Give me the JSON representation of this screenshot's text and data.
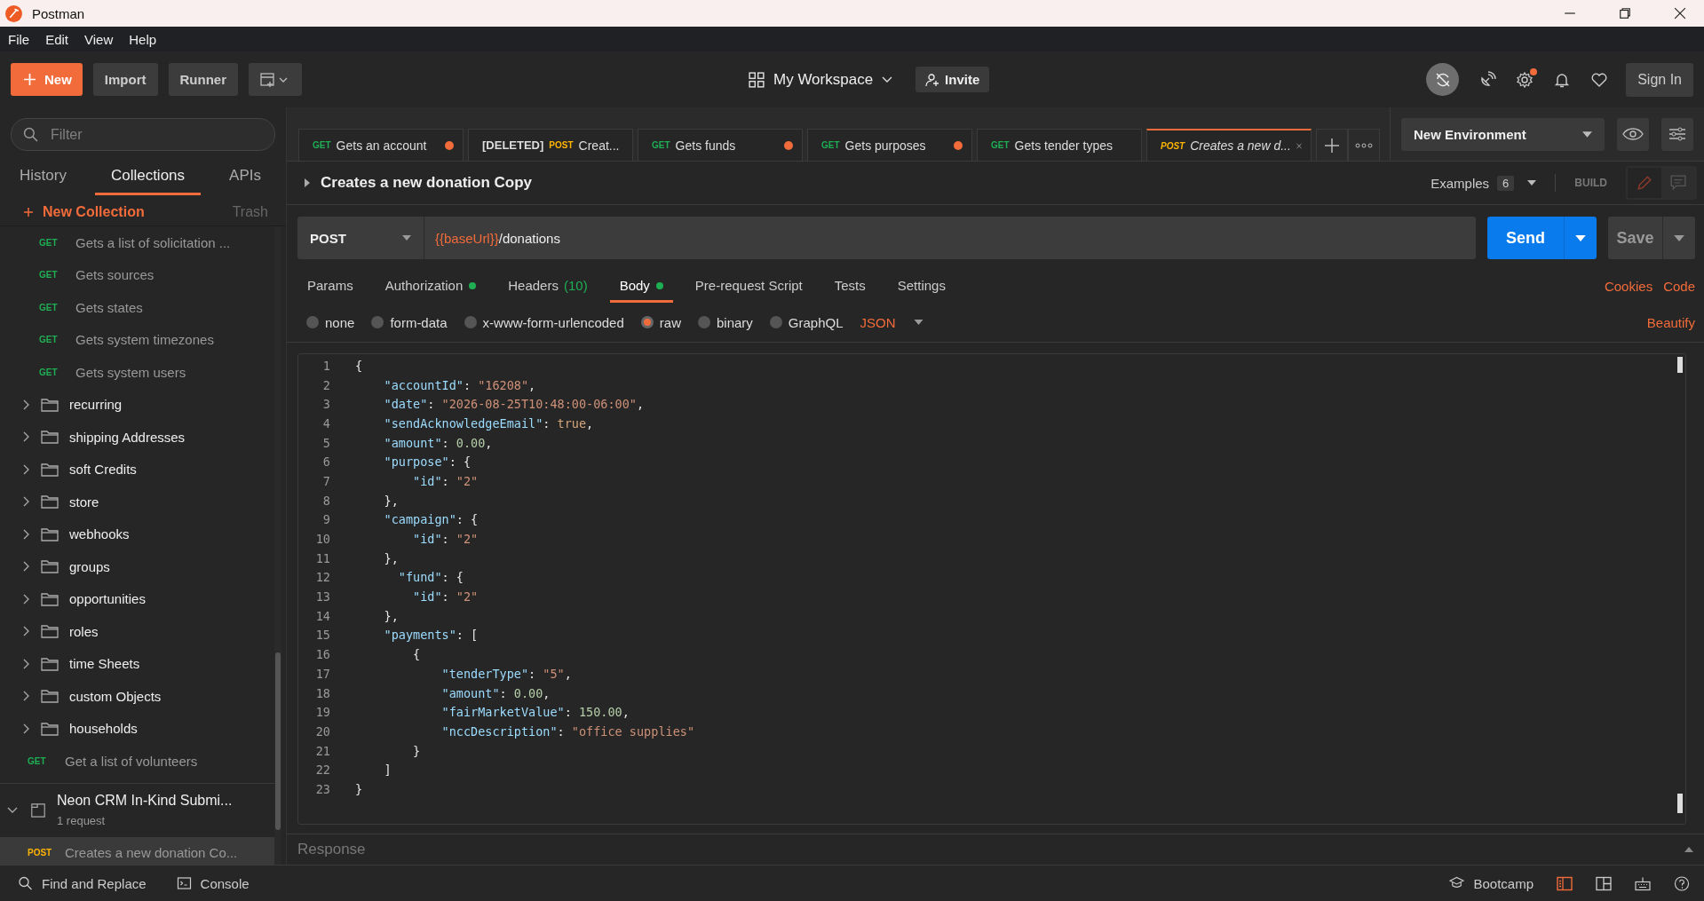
{
  "window": {
    "title": "Postman"
  },
  "menu": [
    "File",
    "Edit",
    "View",
    "Help"
  ],
  "toolbar": {
    "new_button": "New",
    "import_button": "Import",
    "runner_button": "Runner",
    "workspace": "My Workspace",
    "invite_button": "Invite",
    "sign_in_button": "Sign In",
    "settings_badge": true
  },
  "sidebar": {
    "filter_placeholder": "Filter",
    "tabs": [
      {
        "label": "History",
        "selected": false
      },
      {
        "label": "Collections",
        "selected": true
      },
      {
        "label": "APIs",
        "selected": false
      }
    ],
    "new_collection": "New Collection",
    "trash": "Trash",
    "items": [
      {
        "kind": "folder_request",
        "method": "GET",
        "name": "Gets a list of solicitation ..."
      },
      {
        "kind": "folder_request",
        "method": "GET",
        "name": "Gets sources"
      },
      {
        "kind": "folder_request",
        "method": "GET",
        "name": "Gets states"
      },
      {
        "kind": "folder_request",
        "method": "GET",
        "name": "Gets system timezones"
      },
      {
        "kind": "folder_request",
        "method": "GET",
        "name": "Gets system users"
      },
      {
        "kind": "folder",
        "name": "recurring",
        "expanded": false
      },
      {
        "kind": "folder",
        "name": "shipping Addresses",
        "expanded": false
      },
      {
        "kind": "folder",
        "name": "soft Credits",
        "expanded": false
      },
      {
        "kind": "folder",
        "name": "store",
        "expanded": false
      },
      {
        "kind": "folder",
        "name": "webhooks",
        "expanded": false
      },
      {
        "kind": "folder",
        "name": "groups",
        "expanded": false
      },
      {
        "kind": "folder",
        "name": "opportunities",
        "expanded": false
      },
      {
        "kind": "folder",
        "name": "roles",
        "expanded": false
      },
      {
        "kind": "folder",
        "name": "time Sheets",
        "expanded": false
      },
      {
        "kind": "folder",
        "name": "custom Objects",
        "expanded": false
      },
      {
        "kind": "folder",
        "name": "households",
        "expanded": false
      },
      {
        "kind": "request",
        "method": "GET",
        "name": "Get a list of volunteers"
      }
    ],
    "collections": [
      {
        "name": "Neon CRM In-Kind Submi...",
        "count": "1 request",
        "expanded": true,
        "children": [
          {
            "method": "POST",
            "name": "Creates a new donation Co...",
            "selected": true
          }
        ]
      }
    ]
  },
  "tabs": [
    {
      "method": "GET",
      "name": "Gets an account",
      "modified": true,
      "selected": false
    },
    {
      "method": "POST",
      "prefix": "[DELETED]",
      "name": "Creat...",
      "modified": false,
      "selected": false
    },
    {
      "method": "GET",
      "name": "Gets funds",
      "modified": true,
      "selected": false
    },
    {
      "method": "GET",
      "name": "Gets purposes",
      "modified": true,
      "selected": false
    },
    {
      "method": "GET",
      "name": "Gets tender types",
      "modified": false,
      "selected": false
    },
    {
      "method": "POST",
      "name": "Creates a new d...",
      "modified": false,
      "selected": true
    }
  ],
  "environment": "New Environment",
  "request": {
    "title": "Creates a new donation Copy",
    "examples_label": "Examples",
    "examples_count": "6",
    "build_label": "BUILD",
    "method": "POST",
    "url_variable": "{{baseUrl}}",
    "url_path": "/donations",
    "send_button": "Send",
    "save_button": "Save",
    "tabs": [
      {
        "label": "Params",
        "dot": false,
        "selected": false
      },
      {
        "label": "Authorization",
        "dot": true,
        "selected": false
      },
      {
        "label": "Headers",
        "dot": false,
        "count": "(10)",
        "selected": false
      },
      {
        "label": "Body",
        "dot": true,
        "selected": true
      },
      {
        "label": "Pre-request Script",
        "dot": false,
        "selected": false
      },
      {
        "label": "Tests",
        "dot": false,
        "selected": false
      },
      {
        "label": "Settings",
        "dot": false,
        "selected": false
      }
    ],
    "links": [
      "Cookies",
      "Code"
    ],
    "body_modes": [
      {
        "label": "none",
        "selected": false
      },
      {
        "label": "form-data",
        "selected": false
      },
      {
        "label": "x-www-form-urlencoded",
        "selected": false
      },
      {
        "label": "raw",
        "selected": true
      },
      {
        "label": "binary",
        "selected": false
      },
      {
        "label": "GraphQL",
        "selected": false
      }
    ],
    "format": "JSON",
    "beautify": "Beautify",
    "code": [
      {
        "number": "1",
        "tokens": [
          {
            "kind": "punct",
            "text": "{"
          }
        ]
      },
      {
        "number": "2",
        "tokens": [
          {
            "kind": "key",
            "text": "    \"accountId\""
          },
          {
            "kind": "punct",
            "text": ": "
          },
          {
            "kind": "string",
            "text": "\"16208\""
          },
          {
            "kind": "punct",
            "text": ","
          }
        ]
      },
      {
        "number": "3",
        "tokens": [
          {
            "kind": "key",
            "text": "    \"date\""
          },
          {
            "kind": "punct",
            "text": ": "
          },
          {
            "kind": "string",
            "text": "\"2026-08-25T10:48:00-06:00\""
          },
          {
            "kind": "punct",
            "text": ","
          }
        ]
      },
      {
        "number": "4",
        "tokens": [
          {
            "kind": "key",
            "text": "    \"sendAcknowledgeEmail\""
          },
          {
            "kind": "punct",
            "text": ": "
          },
          {
            "kind": "bool",
            "text": "true"
          },
          {
            "kind": "punct",
            "text": ","
          }
        ]
      },
      {
        "number": "5",
        "tokens": [
          {
            "kind": "key",
            "text": "    \"amount\""
          },
          {
            "kind": "punct",
            "text": ": "
          },
          {
            "kind": "number",
            "text": "0.00"
          },
          {
            "kind": "punct",
            "text": ","
          }
        ]
      },
      {
        "number": "6",
        "tokens": [
          {
            "kind": "key",
            "text": "    \"purpose\""
          },
          {
            "kind": "punct",
            "text": ": {"
          }
        ]
      },
      {
        "number": "7",
        "tokens": [
          {
            "kind": "key",
            "text": "        \"id\""
          },
          {
            "kind": "punct",
            "text": ": "
          },
          {
            "kind": "string",
            "text": "\"2\""
          }
        ]
      },
      {
        "number": "8",
        "tokens": [
          {
            "kind": "punct",
            "text": "    },"
          }
        ]
      },
      {
        "number": "9",
        "tokens": [
          {
            "kind": "key",
            "text": "    \"campaign\""
          },
          {
            "kind": "punct",
            "text": ": {"
          }
        ]
      },
      {
        "number": "10",
        "tokens": [
          {
            "kind": "key",
            "text": "        \"id\""
          },
          {
            "kind": "punct",
            "text": ": "
          },
          {
            "kind": "string",
            "text": "\"2\""
          }
        ]
      },
      {
        "number": "11",
        "tokens": [
          {
            "kind": "punct",
            "text": "    },"
          }
        ]
      },
      {
        "number": "12",
        "tokens": [
          {
            "kind": "key",
            "text": "      \"fund\""
          },
          {
            "kind": "punct",
            "text": ": {"
          }
        ]
      },
      {
        "number": "13",
        "tokens": [
          {
            "kind": "key",
            "text": "        \"id\""
          },
          {
            "kind": "punct",
            "text": ": "
          },
          {
            "kind": "string",
            "text": "\"2\""
          }
        ]
      },
      {
        "number": "14",
        "tokens": [
          {
            "kind": "punct",
            "text": "    },"
          }
        ]
      },
      {
        "number": "15",
        "tokens": [
          {
            "kind": "key",
            "text": "    \"payments\""
          },
          {
            "kind": "punct",
            "text": ": ["
          }
        ]
      },
      {
        "number": "16",
        "tokens": [
          {
            "kind": "punct",
            "text": "        {"
          }
        ]
      },
      {
        "number": "17",
        "tokens": [
          {
            "kind": "key",
            "text": "            \"tenderType\""
          },
          {
            "kind": "punct",
            "text": ": "
          },
          {
            "kind": "string",
            "text": "\"5\""
          },
          {
            "kind": "punct",
            "text": ","
          }
        ]
      },
      {
        "number": "18",
        "tokens": [
          {
            "kind": "key",
            "text": "            \"amount\""
          },
          {
            "kind": "punct",
            "text": ": "
          },
          {
            "kind": "number",
            "text": "0.00"
          },
          {
            "kind": "punct",
            "text": ","
          }
        ]
      },
      {
        "number": "19",
        "tokens": [
          {
            "kind": "key",
            "text": "            \"fairMarketValue\""
          },
          {
            "kind": "punct",
            "text": ": "
          },
          {
            "kind": "number",
            "text": "150.00"
          },
          {
            "kind": "punct",
            "text": ","
          }
        ]
      },
      {
        "number": "20",
        "tokens": [
          {
            "kind": "key",
            "text": "            \"nccDescription\""
          },
          {
            "kind": "punct",
            "text": ": "
          },
          {
            "kind": "string",
            "text": "\"office supplies\""
          }
        ]
      },
      {
        "number": "21",
        "tokens": [
          {
            "kind": "punct",
            "text": "        }"
          }
        ]
      },
      {
        "number": "22",
        "tokens": [
          {
            "kind": "punct",
            "text": "    ]"
          }
        ]
      },
      {
        "number": "23",
        "tokens": [
          {
            "kind": "punct",
            "text": "}"
          }
        ]
      }
    ]
  },
  "response_label": "Response",
  "status_bar": {
    "find_replace": "Find and Replace",
    "console": "Console",
    "bootcamp": "Bootcamp"
  }
}
